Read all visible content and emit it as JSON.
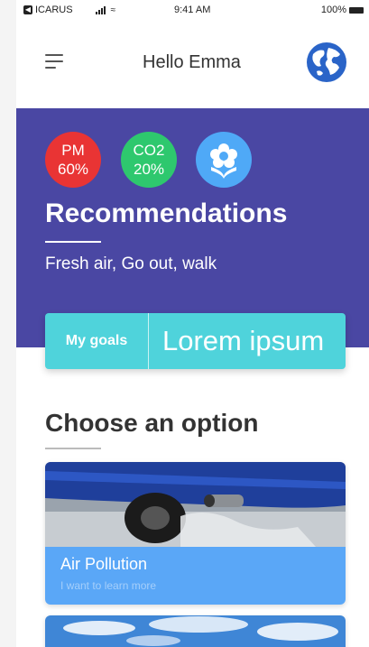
{
  "status_bar": {
    "carrier": "ICARUS",
    "time": "9:41 AM",
    "battery": "100%"
  },
  "header": {
    "greeting": "Hello Emma"
  },
  "hero": {
    "pm_label": "PM",
    "pm_value": "60%",
    "co2_label": "CO2",
    "co2_value": "20%",
    "title": "Recommendations",
    "subtitle": "Fresh air, Go out, walk"
  },
  "goals": {
    "label": "My goals",
    "value": "Lorem ipsum"
  },
  "options": {
    "heading": "Choose an option",
    "cards": [
      {
        "title": "Air Pollution",
        "subtitle": "I want to learn more"
      }
    ]
  },
  "colors": {
    "hero_bg": "#4a47a3",
    "pm": "#e93434",
    "co2": "#2ec86e",
    "flower": "#4fa9f7",
    "goals": "#4fd3db",
    "card_footer": "#5aa7f7"
  }
}
